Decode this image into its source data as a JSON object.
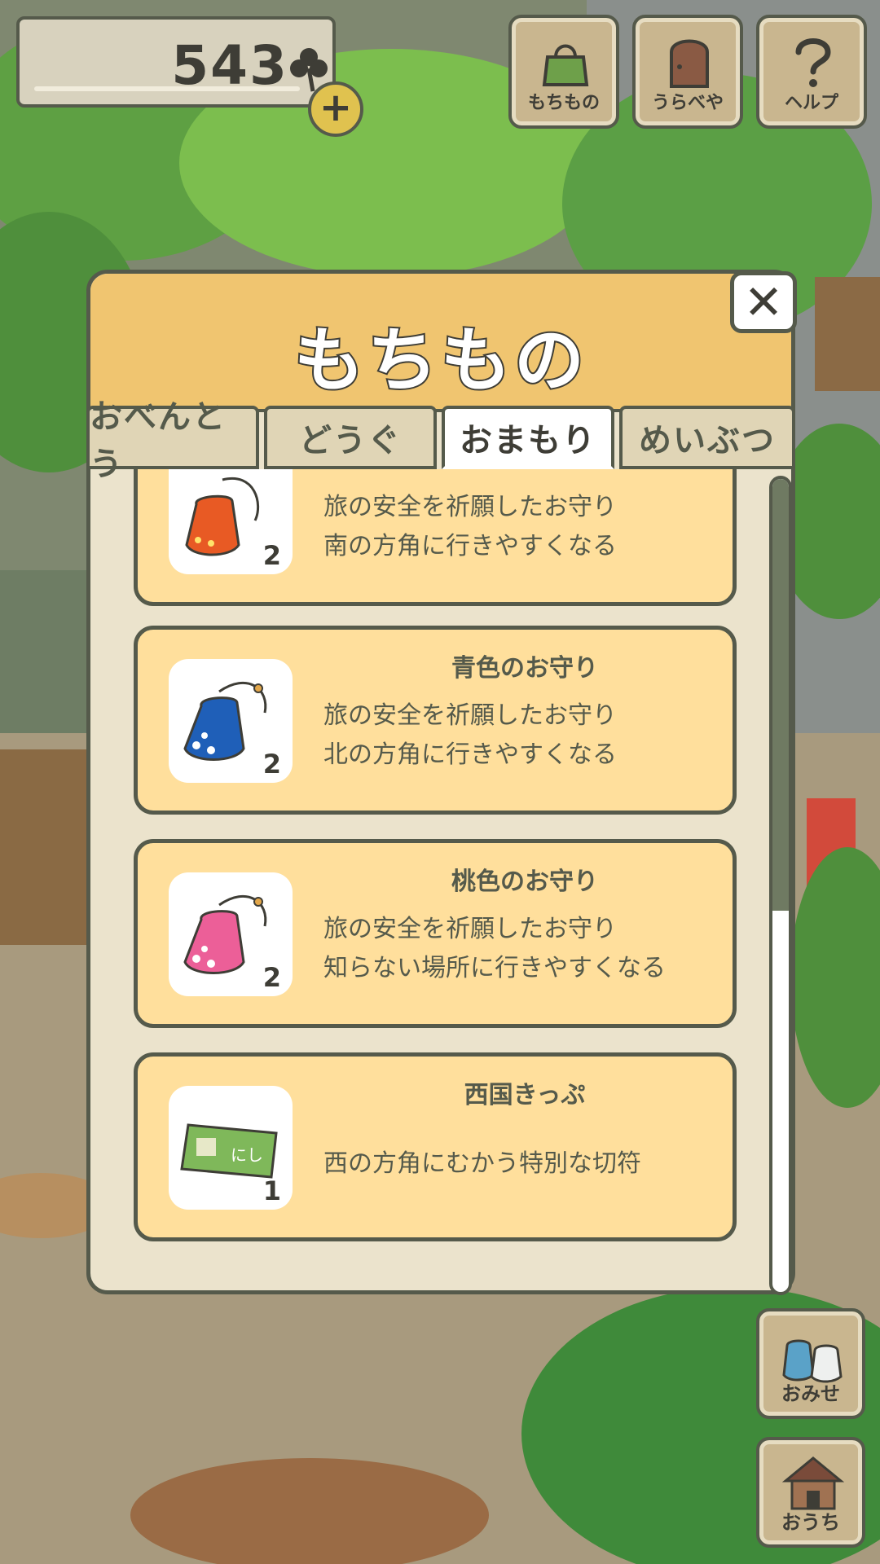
{
  "currency": {
    "count": "543",
    "icon": "clover-icon",
    "add_label": "+"
  },
  "top_buttons": [
    {
      "label": "もちもの",
      "icon": "bag-icon"
    },
    {
      "label": "うらべや",
      "icon": "door-icon"
    },
    {
      "label": "ヘルプ",
      "icon": "question-icon"
    }
  ],
  "modal": {
    "title": "もちもの",
    "close_label": "✕",
    "tabs": [
      "おべんとう",
      "どうぐ",
      "おまもり",
      "めいぶつ"
    ],
    "active_tab": "おまもり",
    "items": [
      {
        "title": "",
        "desc1": "旅の安全を祈願したお守り",
        "desc2": "南の方角に行きやすくなる",
        "qty": "2",
        "icon": "orange-charm-icon",
        "color": "#e85a24"
      },
      {
        "title": "青色のお守り",
        "desc1": "旅の安全を祈願したお守り",
        "desc2": "北の方角に行きやすくなる",
        "qty": "2",
        "icon": "blue-charm-icon",
        "color": "#1f5fb8"
      },
      {
        "title": "桃色のお守り",
        "desc1": "旅の安全を祈願したお守り",
        "desc2": "知らない場所に行きやすくなる",
        "qty": "2",
        "icon": "pink-charm-icon",
        "color": "#ec5f98"
      },
      {
        "title": "西国きっぷ",
        "desc1": "西の方角にむかう特別な切符",
        "desc2": "",
        "qty": "1",
        "icon": "ticket-icon",
        "ticket_text": "にし"
      }
    ]
  },
  "side_buttons": [
    {
      "label": "おみせ",
      "icon": "shop-bags-icon"
    },
    {
      "label": "おうち",
      "icon": "house-icon"
    }
  ],
  "colors": {
    "accent": "#f0c570",
    "card": "#ffdf9c",
    "outline": "#555a4b"
  }
}
